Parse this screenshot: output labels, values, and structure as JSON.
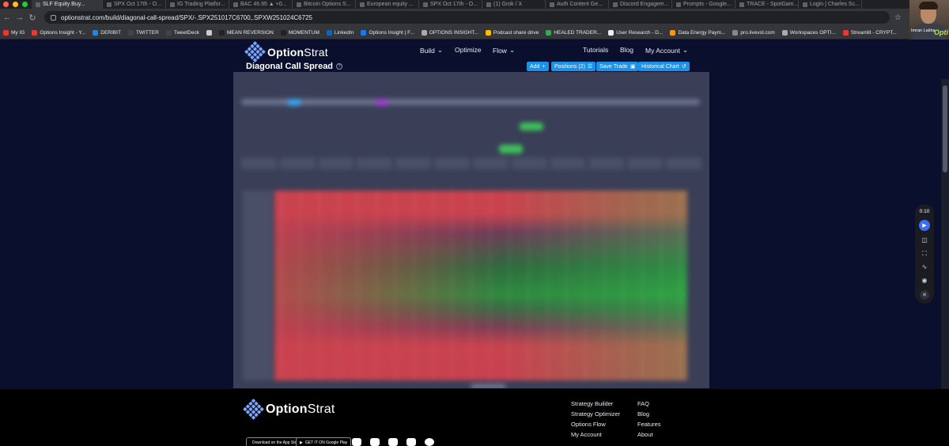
{
  "browser": {
    "tabs": [
      {
        "label": "SLF Equity Buy..."
      },
      {
        "label": "SPX Oct 17th - O..."
      },
      {
        "label": "IG Trading Platfor..."
      },
      {
        "label": "BAC 46.95 ▲ +0..."
      },
      {
        "label": "Bitcoin Options S..."
      },
      {
        "label": "European equity ..."
      },
      {
        "label": "SPX Oct 17th - O..."
      },
      {
        "label": "(1) Grok / X"
      },
      {
        "label": "Auth Content Ge..."
      },
      {
        "label": "Discord Engagem..."
      },
      {
        "label": "Prompts - Google..."
      },
      {
        "label": "TRACE - SpotGam..."
      },
      {
        "label": "Login | Charles Sc..."
      }
    ],
    "url": "optionstrat.com/build/diagonal-call-spread/SPX/-.SPX251017C6700,.SPXW251024C6725",
    "bookmarks": [
      {
        "label": "My IG",
        "color": "#e53935"
      },
      {
        "label": "Options Insight - Y...",
        "color": "#e53935"
      },
      {
        "label": "DERIBIT",
        "color": "#1e88e5"
      },
      {
        "label": "TWITTER",
        "color": "#444444"
      },
      {
        "label": "TweetDeck",
        "color": "#444444"
      },
      {
        "label": "",
        "color": "#cccccc"
      },
      {
        "label": "MEAN REVERSION",
        "color": "#222222"
      },
      {
        "label": "MOMENTUM",
        "color": "#222222"
      },
      {
        "label": "LinkedIn",
        "color": "#0a66c2"
      },
      {
        "label": "Options Insight | F...",
        "color": "#1877f2"
      },
      {
        "label": "OPTIONS INSIGHT...",
        "color": "#aaaaaa"
      },
      {
        "label": "Podcast share drive",
        "color": "#fbbc04"
      },
      {
        "label": "HEALED TRADER...",
        "color": "#34a853"
      },
      {
        "label": "User Research - D...",
        "color": "#eeeeee"
      },
      {
        "label": "Data Energy Paym...",
        "color": "#ff9800"
      },
      {
        "label": "pro.livevol.com",
        "color": "#888888"
      },
      {
        "label": "Workspaces OPTI...",
        "color": "#aaaaaa"
      },
      {
        "label": "Streamlit - CRYPT...",
        "color": "#e53935"
      }
    ],
    "webcam_name": "Imran Lakha",
    "webcam_brand": "Opti"
  },
  "site": {
    "brand_bold": "Option",
    "brand_light": "Strat",
    "nav": {
      "build": "Build",
      "optimize": "Optimize",
      "flow": "Flow",
      "tutorials": "Tutorials",
      "blog": "Blog",
      "account": "My Account"
    },
    "page_title": "Diagonal Call Spread",
    "actions": {
      "add": "Add",
      "positions": "Positions (2)",
      "save": "Save Trade",
      "historical": "Historical Chart"
    },
    "accent": "#1e90e6"
  },
  "recorder": {
    "time": "0:10"
  },
  "footer": {
    "brand_bold": "Option",
    "brand_light": "Strat",
    "col1": [
      "Strategy Builder",
      "Strategy Optimizer",
      "Options Flow",
      "My Account"
    ],
    "col2": [
      "FAQ",
      "Blog",
      "Features",
      "About"
    ],
    "app_store": "Download on the App Store",
    "google_play": "GET IT ON Google Play"
  }
}
